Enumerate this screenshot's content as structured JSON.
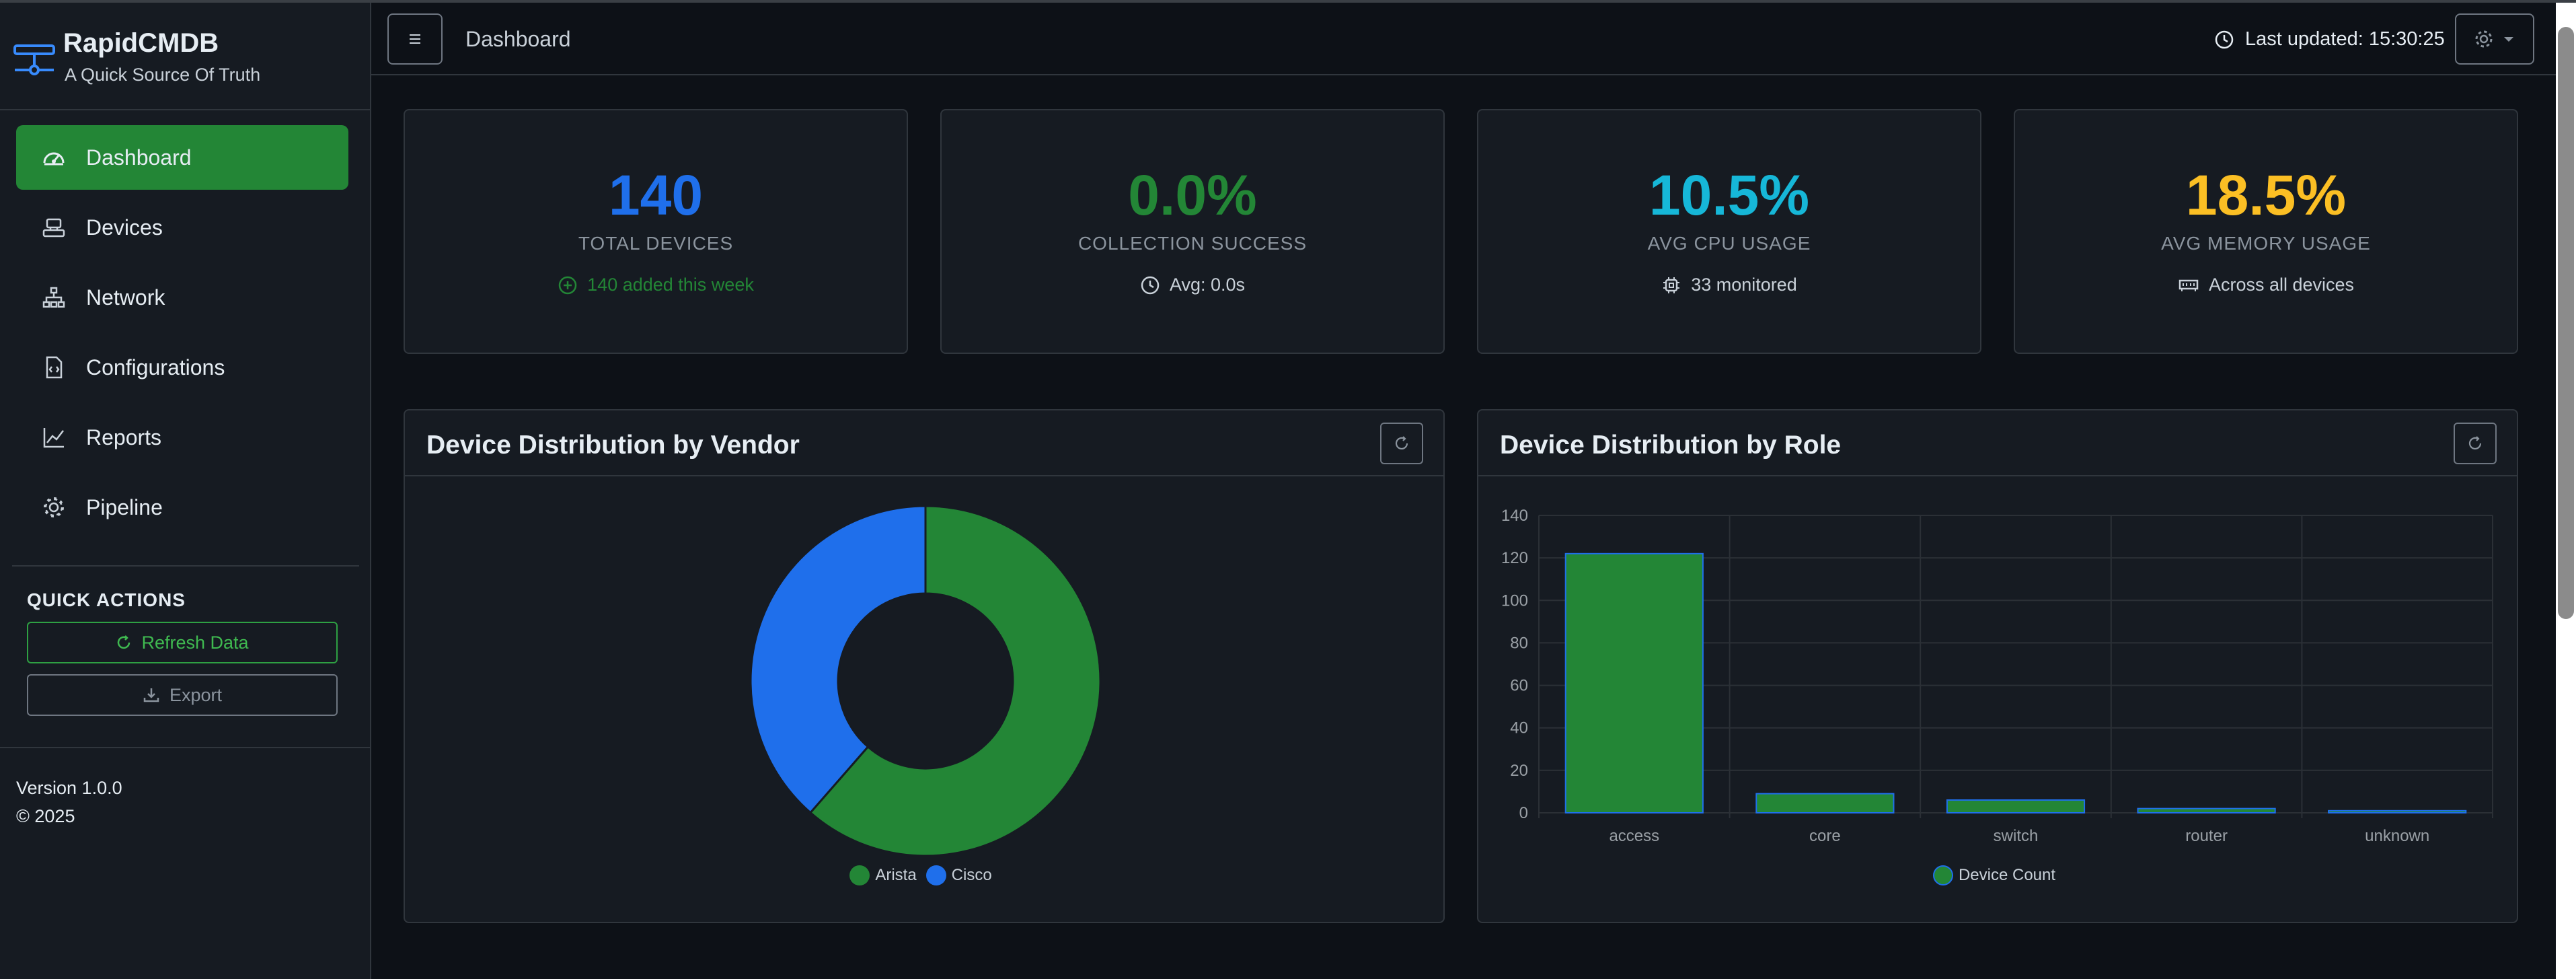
{
  "app": {
    "name": "RapidCMDB",
    "tagline": "A Quick Source Of Truth"
  },
  "sidebar": {
    "items": [
      {
        "label": "Dashboard",
        "icon": "speedometer-icon",
        "active": true
      },
      {
        "label": "Devices",
        "icon": "devices-icon",
        "active": false
      },
      {
        "label": "Network",
        "icon": "diagram-icon",
        "active": false
      },
      {
        "label": "Configurations",
        "icon": "file-code-icon",
        "active": false
      },
      {
        "label": "Reports",
        "icon": "graph-up-icon",
        "active": false
      },
      {
        "label": "Pipeline",
        "icon": "gear-icon",
        "active": false
      }
    ],
    "quick_actions": {
      "title": "QUICK ACTIONS",
      "refresh_label": "Refresh Data",
      "export_label": "Export"
    },
    "version": "Version 1.0.0",
    "copyright": "© 2025"
  },
  "topbar": {
    "page_title": "Dashboard",
    "last_updated": "Last updated: 15:30:25"
  },
  "stats": [
    {
      "value": "140",
      "label": "TOTAL DEVICES",
      "sub": "140 added this week",
      "icon": "plus-circle-icon",
      "color": "#1f6feb",
      "sub_color": "#238636"
    },
    {
      "value": "0.0%",
      "label": "COLLECTION SUCCESS",
      "sub": "Avg: 0.0s",
      "icon": "clock-icon",
      "color": "#238636",
      "sub_color": "#c9d1d9"
    },
    {
      "value": "10.5%",
      "label": "AVG CPU USAGE",
      "sub": "33 monitored",
      "icon": "cpu-icon",
      "color": "#16b7d8",
      "sub_color": "#c9d1d9"
    },
    {
      "value": "18.5%",
      "label": "AVG MEMORY USAGE",
      "sub": "Across all devices",
      "icon": "memory-icon",
      "color": "#fbbf24",
      "sub_color": "#c9d1d9"
    }
  ],
  "vendor_chart": {
    "title": "Device Distribution by Vendor"
  },
  "role_chart": {
    "title": "Device Distribution by Role"
  },
  "chart_data": [
    {
      "type": "pie",
      "title": "Device Distribution by Vendor",
      "categories": [
        "Arista",
        "Cisco"
      ],
      "values": [
        86,
        54
      ],
      "colors": [
        "#238636",
        "#1f6feb"
      ],
      "donut": true,
      "legend": "bottom"
    },
    {
      "type": "bar",
      "title": "Device Distribution by Role",
      "categories": [
        "access",
        "core",
        "switch",
        "router",
        "unknown"
      ],
      "series": [
        {
          "name": "Device Count",
          "values": [
            122,
            9,
            6,
            2,
            1
          ]
        }
      ],
      "ylim": [
        0,
        140
      ],
      "yticks": [
        0,
        20,
        40,
        60,
        80,
        100,
        120,
        140
      ],
      "grid": true,
      "legend": "bottom",
      "colors": [
        "#238636"
      ]
    }
  ]
}
